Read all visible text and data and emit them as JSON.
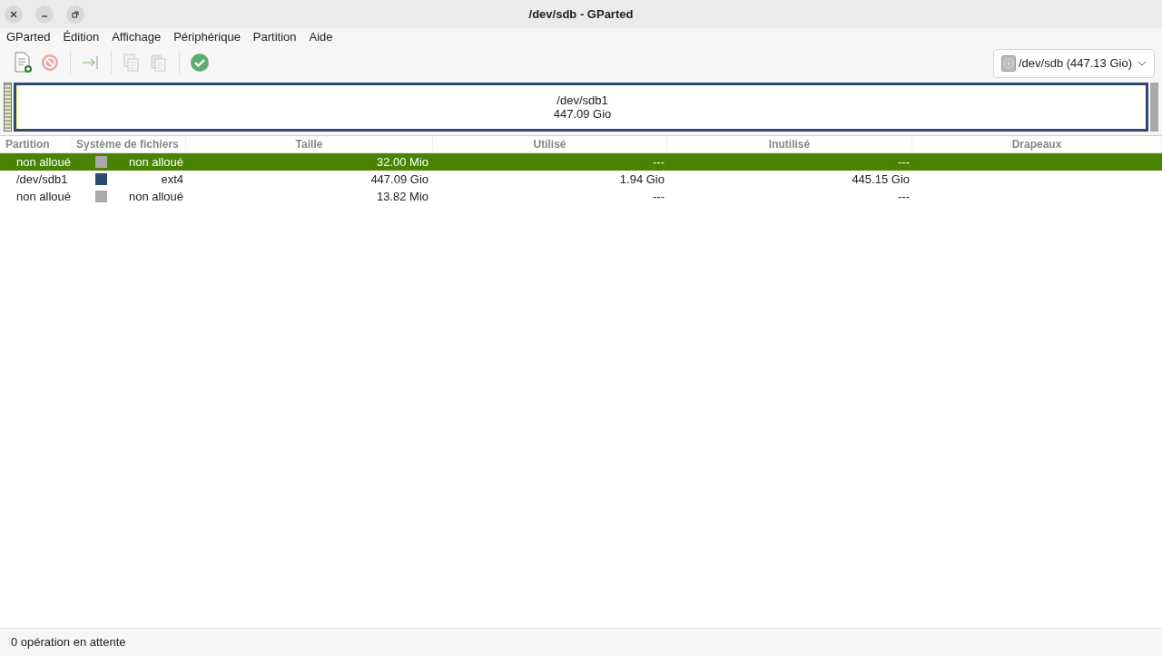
{
  "window": {
    "title": "/dev/sdb - GParted"
  },
  "menu": [
    "GParted",
    "Édition",
    "Affichage",
    "Périphérique",
    "Partition",
    "Aide"
  ],
  "toolbar": [
    {
      "kind": "new",
      "disabled": false
    },
    {
      "kind": "delete",
      "disabled": true
    },
    {
      "kind": "separator"
    },
    {
      "kind": "resize",
      "disabled": true
    },
    {
      "kind": "separator"
    },
    {
      "kind": "copy",
      "disabled": true
    },
    {
      "kind": "paste",
      "disabled": true
    },
    {
      "kind": "separator"
    },
    {
      "kind": "apply",
      "disabled": false
    }
  ],
  "device_selector": {
    "label": "/dev/sdb (447.13 Gio)"
  },
  "disk_map": [
    {
      "kind": "unallocated",
      "selected": true
    },
    {
      "kind": "partition",
      "name": "/dev/sdb1",
      "size": "447.09 Gio",
      "color": "#2c4a6e",
      "selected": false
    },
    {
      "kind": "unallocated",
      "selected": false
    }
  ],
  "table": {
    "columns": [
      "Partition",
      "Système de fichiers",
      "Taille",
      "Utilisé",
      "Inutilisé",
      "Drapeaux"
    ],
    "rows": [
      {
        "partition": "non alloué",
        "color": "#a9a9a9",
        "filesystem": "non alloué",
        "size": "32.00 Mio",
        "used": "---",
        "unused": "---",
        "selected": true
      },
      {
        "partition": "/dev/sdb1",
        "color": "#2c4a6e",
        "filesystem": "ext4",
        "size": "447.09 Gio",
        "used": "1.94 Gio",
        "unused": "445.15 Gio",
        "selected": false
      },
      {
        "partition": "non alloué",
        "color": "#a9a9a9",
        "filesystem": "non alloué",
        "size": "13.82 Mio",
        "used": "---",
        "unused": "---",
        "selected": false
      }
    ]
  },
  "status_bar": "0 opération en attente"
}
